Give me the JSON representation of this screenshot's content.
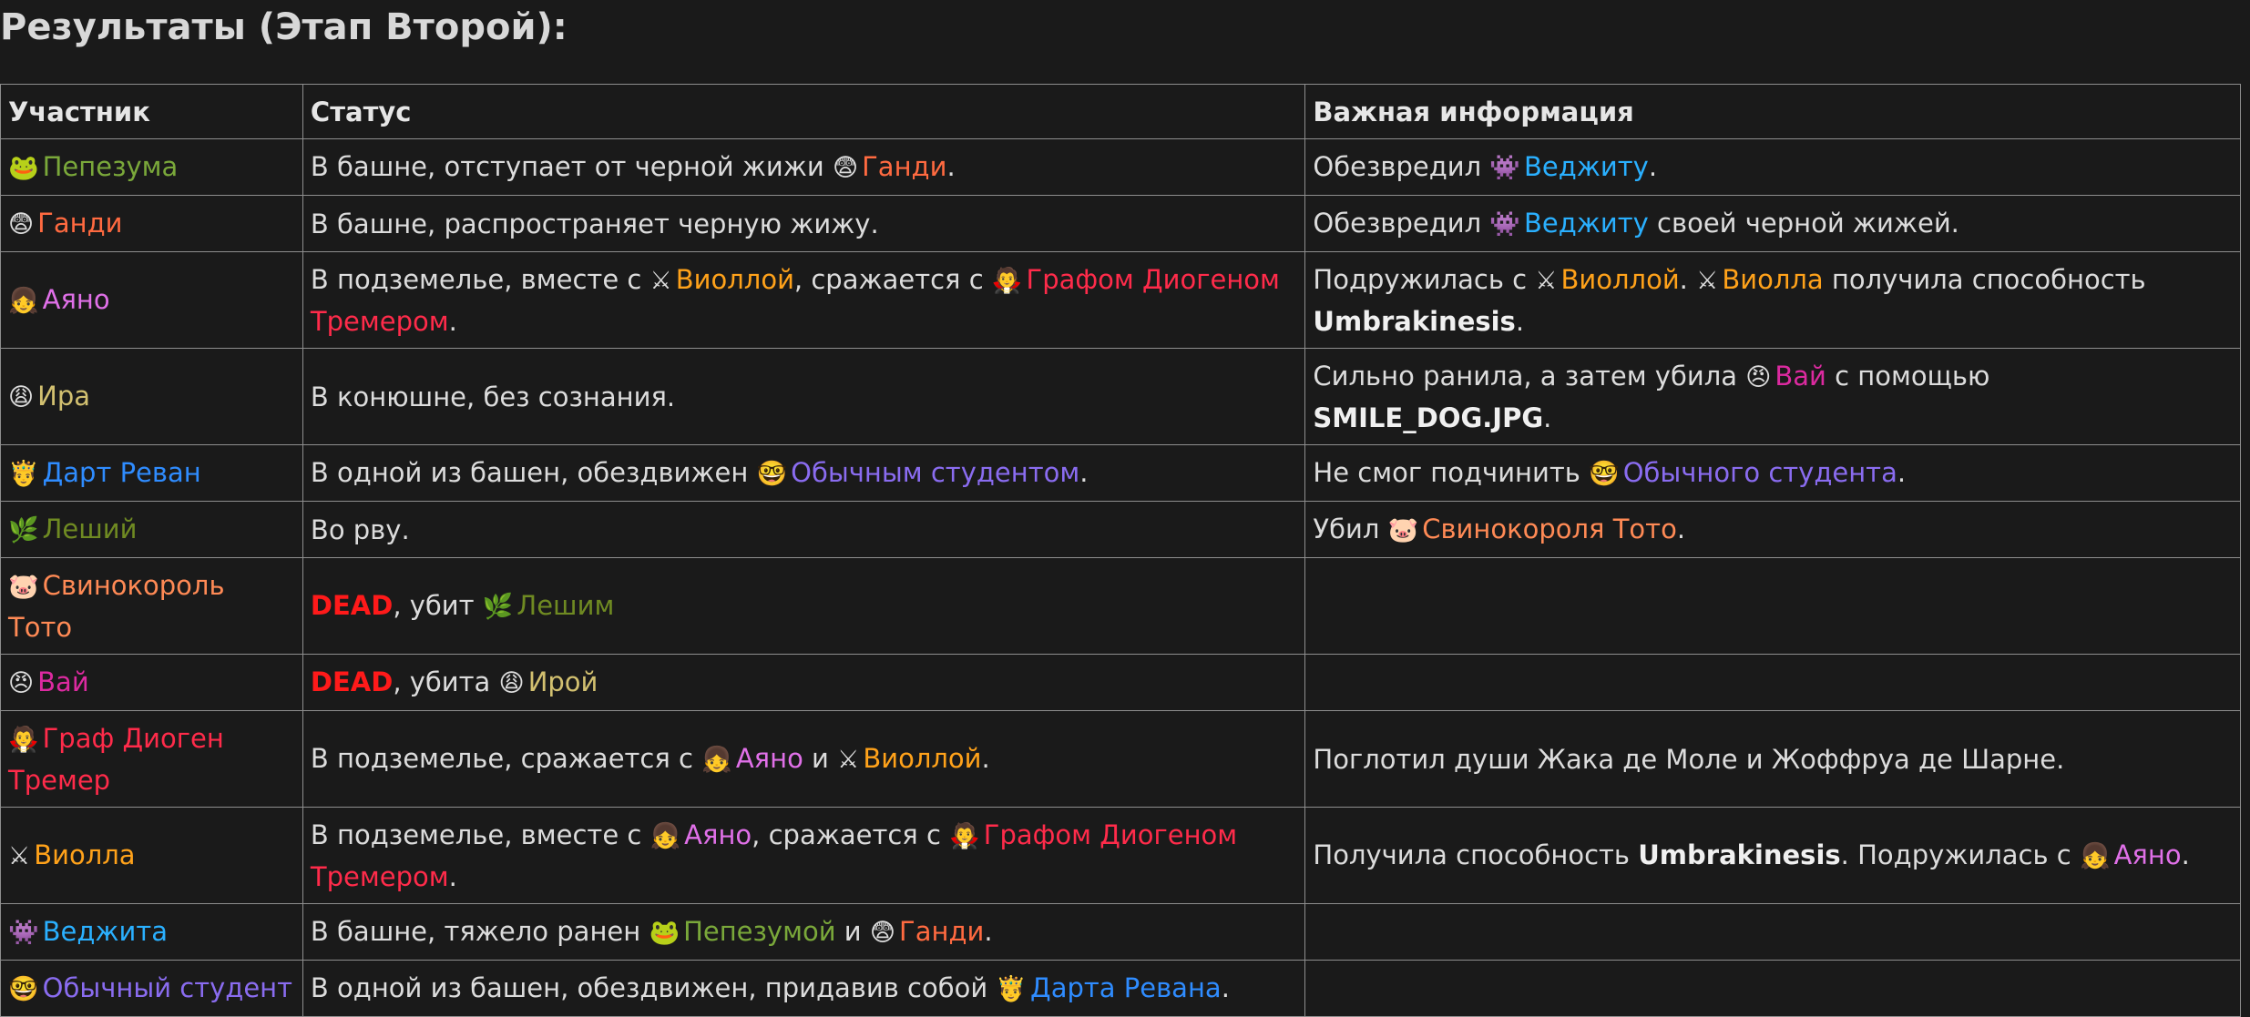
{
  "title": "Результаты (Этап Второй):",
  "headers": [
    "Участник",
    "Статус",
    "Важная информация"
  ],
  "colors": {
    "pepezuma": "#7aa83a",
    "gandi": "#ff6a40",
    "ayano": "#e070e8",
    "ira": "#d2c070",
    "revan": "#2f8cff",
    "leshiy": "#6f8a22",
    "toto": "#ff8a55",
    "vai": "#dc2aa0",
    "diogen": "#ff2b4a",
    "viola": "#ffa21a",
    "vegita": "#2ab0ff",
    "student": "#8a6cf0"
  },
  "rows": [
    {
      "participant": [
        {
          "emoji": "🐸",
          "text": "Пепезума",
          "color": "pepezuma"
        }
      ],
      "status": [
        {
          "text": "В башне, отступает от черной жижи "
        },
        {
          "emoji": "😨",
          "text": "Ганди",
          "color": "gandi"
        },
        {
          "text": "."
        }
      ],
      "info": [
        {
          "text": "Обезвредил "
        },
        {
          "emoji": "👾",
          "text": "Веджиту",
          "color": "vegita"
        },
        {
          "text": "."
        }
      ]
    },
    {
      "participant": [
        {
          "emoji": "😨",
          "text": "Ганди",
          "color": "gandi"
        }
      ],
      "status": [
        {
          "text": "В башне, распространяет черную жижу."
        }
      ],
      "info": [
        {
          "text": "Обезвредил "
        },
        {
          "emoji": "👾",
          "text": "Веджиту",
          "color": "vegita"
        },
        {
          "text": " своей черной жижей."
        }
      ]
    },
    {
      "participant": [
        {
          "emoji": "👧",
          "text": "Аяно",
          "color": "ayano"
        }
      ],
      "status": [
        {
          "text": "В подземелье, вместе с "
        },
        {
          "emoji": "⚔",
          "text": "Виоллой",
          "color": "viola"
        },
        {
          "text": ", сражается с "
        },
        {
          "emoji": "🧛",
          "text": "Графом Диогеном Тремером",
          "color": "diogen"
        },
        {
          "text": "."
        }
      ],
      "info": [
        {
          "text": "Подружилась с "
        },
        {
          "emoji": "⚔",
          "text": "Виоллой",
          "color": "viola"
        },
        {
          "text": ". "
        },
        {
          "emoji": "⚔",
          "text": "Виолла",
          "color": "viola"
        },
        {
          "text": " получила способность "
        },
        {
          "text": "Umbrakinesis",
          "style": "bold"
        },
        {
          "text": "."
        }
      ]
    },
    {
      "participant": [
        {
          "emoji": "😩",
          "text": "Ира",
          "color": "ira"
        }
      ],
      "status": [
        {
          "text": "В конюшне, без сознания."
        }
      ],
      "info": [
        {
          "text": "Сильно ранила, а затем убила "
        },
        {
          "emoji": "😠",
          "text": "Вай",
          "color": "vai"
        },
        {
          "text": " с помощью "
        },
        {
          "text": "SMILE_DOG.JPG",
          "style": "bold"
        },
        {
          "text": "."
        }
      ]
    },
    {
      "participant": [
        {
          "emoji": "🤴",
          "text": "Дарт Реван",
          "color": "revan"
        }
      ],
      "status": [
        {
          "text": "В одной из башен, обездвижен "
        },
        {
          "emoji": "🤓",
          "text": "Обычным студентом",
          "color": "student"
        },
        {
          "text": "."
        }
      ],
      "info": [
        {
          "text": "Не смог подчинить "
        },
        {
          "emoji": "🤓",
          "text": "Обычного студента",
          "color": "student"
        },
        {
          "text": "."
        }
      ]
    },
    {
      "participant": [
        {
          "emoji": "🌿",
          "text": "Леший",
          "color": "leshiy"
        }
      ],
      "status": [
        {
          "text": "Во рву."
        }
      ],
      "info": [
        {
          "text": "Убил "
        },
        {
          "emoji": "🐷",
          "text": "Свинокороля Тото",
          "color": "toto"
        },
        {
          "text": "."
        }
      ]
    },
    {
      "participant": [
        {
          "emoji": "🐷",
          "text": "Свинокороль Тото",
          "color": "toto"
        }
      ],
      "status": [
        {
          "text": "DEAD",
          "style": "dead"
        },
        {
          "text": ", убит "
        },
        {
          "emoji": "🌿",
          "text": "Лешим",
          "color": "leshiy"
        }
      ],
      "info": []
    },
    {
      "participant": [
        {
          "emoji": "😠",
          "text": "Вай",
          "color": "vai"
        }
      ],
      "status": [
        {
          "text": "DEAD",
          "style": "dead"
        },
        {
          "text": ", убита "
        },
        {
          "emoji": "😩",
          "text": "Ирой",
          "color": "ira"
        }
      ],
      "info": []
    },
    {
      "participant": [
        {
          "emoji": "🧛",
          "text": "Граф Диоген Тремер",
          "color": "diogen"
        }
      ],
      "status": [
        {
          "text": "В подземелье, сражается с "
        },
        {
          "emoji": "👧",
          "text": "Аяно",
          "color": "ayano"
        },
        {
          "text": " и "
        },
        {
          "emoji": "⚔",
          "text": "Виоллой",
          "color": "viola"
        },
        {
          "text": "."
        }
      ],
      "info": [
        {
          "text": "Поглотил души Жака де Моле и Жоффруа де Шарне."
        }
      ]
    },
    {
      "participant": [
        {
          "emoji": "⚔",
          "text": "Виолла",
          "color": "viola"
        }
      ],
      "status": [
        {
          "text": "В подземелье, вместе с "
        },
        {
          "emoji": "👧",
          "text": "Аяно",
          "color": "ayano"
        },
        {
          "text": ", сражается с "
        },
        {
          "emoji": "🧛",
          "text": "Графом Диогеном Тремером",
          "color": "diogen"
        },
        {
          "text": "."
        }
      ],
      "info": [
        {
          "text": "Получила способность "
        },
        {
          "text": "Umbrakinesis",
          "style": "bold"
        },
        {
          "text": ". Подружилась с "
        },
        {
          "emoji": "👧",
          "text": "Аяно",
          "color": "ayano"
        },
        {
          "text": "."
        }
      ]
    },
    {
      "participant": [
        {
          "emoji": "👾",
          "text": "Веджита",
          "color": "vegita"
        }
      ],
      "status": [
        {
          "text": "В башне, тяжело ранен "
        },
        {
          "emoji": "🐸",
          "text": "Пепезумой",
          "color": "pepezuma"
        },
        {
          "text": " и "
        },
        {
          "emoji": "😨",
          "text": "Ганди",
          "color": "gandi"
        },
        {
          "text": "."
        }
      ],
      "info": []
    },
    {
      "participant": [
        {
          "emoji": "🤓",
          "text": "Обычный студент",
          "color": "student"
        }
      ],
      "status": [
        {
          "text": "В одной из башен, обездвижен, придавив собой "
        },
        {
          "emoji": "🤴",
          "text": "Дарта Ревана",
          "color": "revan"
        },
        {
          "text": "."
        }
      ],
      "info": []
    }
  ]
}
